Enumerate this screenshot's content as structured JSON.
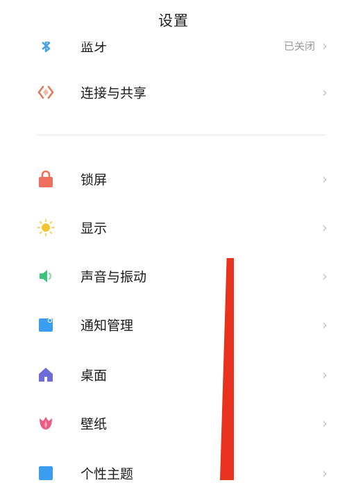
{
  "header": {
    "title": "设置"
  },
  "groups": [
    {
      "items": [
        {
          "label": "蓝牙",
          "value": "已关闭",
          "icon": "bluetooth-icon",
          "color": "#4aa3e8"
        },
        {
          "label": "连接与共享",
          "icon": "share-icon",
          "color": "#e07a5a"
        }
      ]
    },
    {
      "items": [
        {
          "label": "锁屏",
          "icon": "lock-icon",
          "color": "#ef6f5e"
        },
        {
          "label": "显示",
          "icon": "sun-icon",
          "color": "#f5c330"
        },
        {
          "label": "声音与振动",
          "icon": "speaker-icon",
          "color": "#3cc47c"
        },
        {
          "label": "通知管理",
          "icon": "notification-icon",
          "color": "#3a9df0"
        },
        {
          "label": "桌面",
          "icon": "home-icon",
          "color": "#6e6cd8"
        },
        {
          "label": "壁纸",
          "icon": "wallpaper-icon",
          "color": "#ee5a82"
        },
        {
          "label": "个性主题",
          "icon": "theme-icon",
          "color": "#3a9df0"
        }
      ]
    }
  ],
  "chevron": "›",
  "overlay": {
    "color": "#e8321e"
  }
}
